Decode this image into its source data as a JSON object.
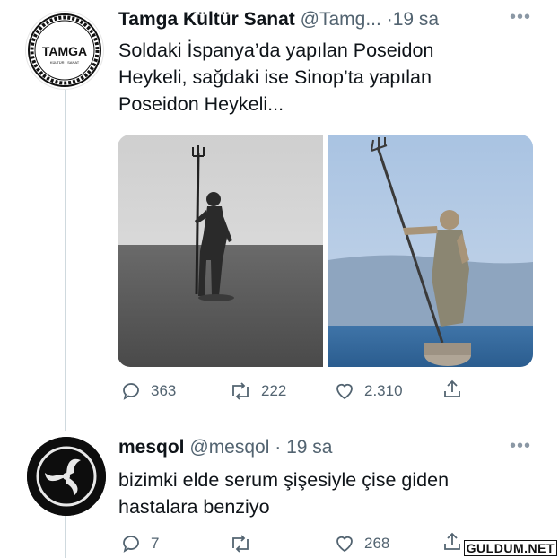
{
  "tweet1": {
    "display_name": "Tamga Kültür Sanat",
    "handle": "@Tamg...",
    "separator": "·",
    "time": "19 sa",
    "text_lines": [
      "Soldaki İspanya’da yapılan Poseidon",
      "Heykeli, sağdaki ise Sinop’ta yapılan",
      "Poseidon Heykeli..."
    ],
    "avatar_text": "TAMGA",
    "avatar_subtext": "KÜLTÜR · SANAT",
    "stats": {
      "replies": "363",
      "retweets": "222",
      "likes": "2.310"
    }
  },
  "tweet2": {
    "display_name": "mesqol",
    "handle": "@mesqol",
    "separator": "·",
    "time": "19 sa",
    "text_lines": [
      "bizimki elde serum şişesiyle çise giden",
      "hastalara benziyo"
    ],
    "stats": {
      "replies": "7",
      "retweets": "",
      "likes": "268"
    }
  },
  "watermark": "GULDUM.NET",
  "colors": {
    "text": "#0f1419",
    "muted": "#536471",
    "line": "#cfd9de"
  }
}
